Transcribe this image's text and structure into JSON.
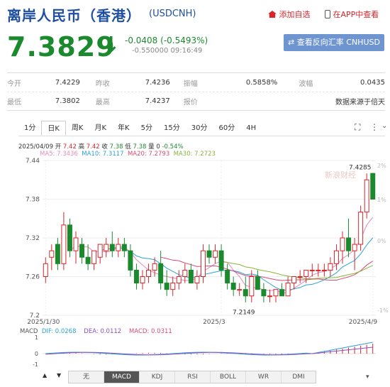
{
  "header": {
    "title": "离岸人民币（香港）",
    "code": "(USDCNH)",
    "add_watch": "添加自选",
    "app_view": "在APP中查看",
    "price": "7.3829",
    "arrow": "↓",
    "change": "-0.0408 (-0.5493%)",
    "sub_change": "-0.550000 09:16:49",
    "reverse_btn": "查看反向汇率 CNHUSD"
  },
  "stats": {
    "row1": [
      {
        "label": "今开",
        "value": "7.4229"
      },
      {
        "label": "昨收",
        "value": "7.4236"
      },
      {
        "label": "振幅",
        "value": "0.5858%"
      },
      {
        "label": "波幅",
        "value": "0.0435"
      }
    ],
    "row2": [
      {
        "label": "最低",
        "value": "7.3802"
      },
      {
        "label": "最高",
        "value": "7.4237"
      },
      {
        "label": "报价",
        "value": ""
      },
      {
        "label": "",
        "value": "数据来源于倍天"
      }
    ]
  },
  "tabs": [
    "1分",
    "日K",
    "周K",
    "月K",
    "年K",
    "5分",
    "15分",
    "30分",
    "60分",
    "4H"
  ],
  "active_tab": "日K",
  "chart": {
    "ohlc_line": {
      "date": "2025/04/09",
      "o_label": "开",
      "o": "7.42",
      "h_label": "高",
      "h": "7.42",
      "c_label": "收",
      "c": "7.38",
      "l_label": "低",
      "l": "7.38",
      "v_label": "量",
      "v": "0",
      "p": "-0.54%"
    },
    "ma": [
      {
        "label": "MA5: 7.3436",
        "color": "#e58bb7"
      },
      {
        "label": "MA10: 7.3117",
        "color": "#2ba1d8"
      },
      {
        "label": "MA20: 7.2793",
        "color": "#d64b72"
      },
      {
        "label": "MA30: 7.2723",
        "color": "#8bb33a"
      }
    ],
    "y_ticks": [
      "7.44",
      "7.38",
      "7.32",
      "7.26",
      "7.2"
    ],
    "pct_ticks": [
      "2%",
      "1%",
      "0%",
      "-1%"
    ],
    "x_ticks": [
      "2025/1/30",
      "2025/3",
      "2025/4/9"
    ],
    "max_label": "7.4285",
    "min_label": "7.2149",
    "watermark": "新浪财经",
    "macd": {
      "name": "MACD",
      "dif": "DIF: 0.0268",
      "dea": "DEA: 0.0112",
      "macd": "MACD: 0.0311",
      "ticks": [
        "1",
        "0",
        "-1"
      ]
    }
  },
  "indicator_tabs": [
    "无",
    "MACD",
    "KDJ",
    "RSI",
    "BOLL",
    "WR",
    "DMI"
  ],
  "active_indicator": "MACD",
  "chart_data": {
    "type": "candlestick",
    "series": [
      {
        "name": "daily",
        "values": [
          [
            7.26,
            7.29,
            7.25,
            7.28
          ],
          [
            7.29,
            7.31,
            7.27,
            7.3
          ],
          [
            7.31,
            7.32,
            7.27,
            7.28
          ],
          [
            7.28,
            7.36,
            7.27,
            7.34
          ],
          [
            7.34,
            7.35,
            7.29,
            7.3
          ],
          [
            7.3,
            7.33,
            7.28,
            7.32
          ],
          [
            7.31,
            7.32,
            7.28,
            7.29
          ],
          [
            7.29,
            7.31,
            7.27,
            7.28
          ],
          [
            7.28,
            7.3,
            7.27,
            7.3
          ],
          [
            7.29,
            7.31,
            7.28,
            7.31
          ],
          [
            7.3,
            7.32,
            7.29,
            7.31
          ],
          [
            7.31,
            7.33,
            7.29,
            7.3
          ],
          [
            7.3,
            7.32,
            7.29,
            7.31
          ],
          [
            7.31,
            7.32,
            7.29,
            7.3
          ],
          [
            7.3,
            7.31,
            7.26,
            7.27
          ],
          [
            7.27,
            7.28,
            7.24,
            7.25
          ],
          [
            7.25,
            7.27,
            7.24,
            7.26
          ],
          [
            7.26,
            7.28,
            7.25,
            7.27
          ],
          [
            7.27,
            7.29,
            7.26,
            7.28
          ],
          [
            7.28,
            7.3,
            7.24,
            7.25
          ],
          [
            7.25,
            7.27,
            7.23,
            7.24
          ],
          [
            7.24,
            7.26,
            7.23,
            7.25
          ],
          [
            7.25,
            7.27,
            7.24,
            7.26
          ],
          [
            7.26,
            7.28,
            7.25,
            7.27
          ],
          [
            7.27,
            7.28,
            7.25,
            7.25
          ],
          [
            7.25,
            7.27,
            7.24,
            7.26
          ],
          [
            7.26,
            7.31,
            7.25,
            7.3
          ],
          [
            7.3,
            7.31,
            7.28,
            7.29
          ],
          [
            7.29,
            7.31,
            7.28,
            7.3
          ],
          [
            7.3,
            7.31,
            7.26,
            7.27
          ],
          [
            7.27,
            7.28,
            7.24,
            7.25
          ],
          [
            7.25,
            7.26,
            7.23,
            7.24
          ],
          [
            7.24,
            7.25,
            7.23,
            7.24
          ],
          [
            7.24,
            7.26,
            7.22,
            7.23
          ],
          [
            7.23,
            7.27,
            7.22,
            7.26
          ],
          [
            7.26,
            7.27,
            7.24,
            7.24
          ],
          [
            7.24,
            7.25,
            7.22,
            7.23
          ],
          [
            7.23,
            7.24,
            7.22,
            7.23
          ],
          [
            7.23,
            7.24,
            7.22,
            7.24
          ],
          [
            7.24,
            7.25,
            7.23,
            7.23
          ],
          [
            7.23,
            7.26,
            7.23,
            7.25
          ],
          [
            7.25,
            7.26,
            7.24,
            7.26
          ],
          [
            7.26,
            7.27,
            7.25,
            7.26
          ],
          [
            7.26,
            7.27,
            7.25,
            7.27
          ],
          [
            7.27,
            7.28,
            7.26,
            7.27
          ],
          [
            7.27,
            7.28,
            7.26,
            7.27
          ],
          [
            7.27,
            7.28,
            7.26,
            7.27
          ],
          [
            7.27,
            7.29,
            7.26,
            7.28
          ],
          [
            7.28,
            7.31,
            7.27,
            7.3
          ],
          [
            7.3,
            7.33,
            7.28,
            7.32
          ],
          [
            7.32,
            7.35,
            7.29,
            7.3
          ],
          [
            7.3,
            7.32,
            7.27,
            7.31
          ],
          [
            7.31,
            7.37,
            7.3,
            7.36
          ],
          [
            7.36,
            7.42,
            7.35,
            7.41
          ],
          [
            7.42,
            7.42,
            7.38,
            7.38
          ]
        ]
      }
    ],
    "ylim": [
      7.2,
      7.44
    ]
  }
}
